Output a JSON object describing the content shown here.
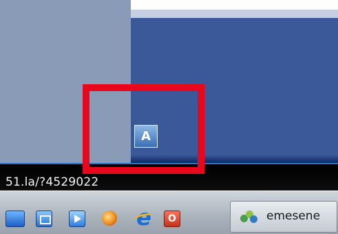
{
  "status_bar": {
    "url_text": "51.la/?4529022"
  },
  "taskbar": {
    "quick_launch": [
      {
        "icon": "show-desktop-icon"
      },
      {
        "icon": "switch-windows-icon"
      },
      {
        "icon": "media-player-icon"
      },
      {
        "icon": "firefox-icon"
      },
      {
        "icon": "internet-explorer-icon",
        "glyph": "e"
      },
      {
        "icon": "opera-icon",
        "glyph": "O"
      }
    ],
    "task_button": {
      "icon": "emesene-buddies-icon",
      "label": "emesene"
    }
  },
  "overlay": {
    "highlight_color": "#e8071b",
    "tray_icon_glyph": "A"
  },
  "colors": {
    "panel_blue": "#3b5898",
    "left_grey": "#8a9bb8",
    "accent_line": "#2a73cc"
  }
}
